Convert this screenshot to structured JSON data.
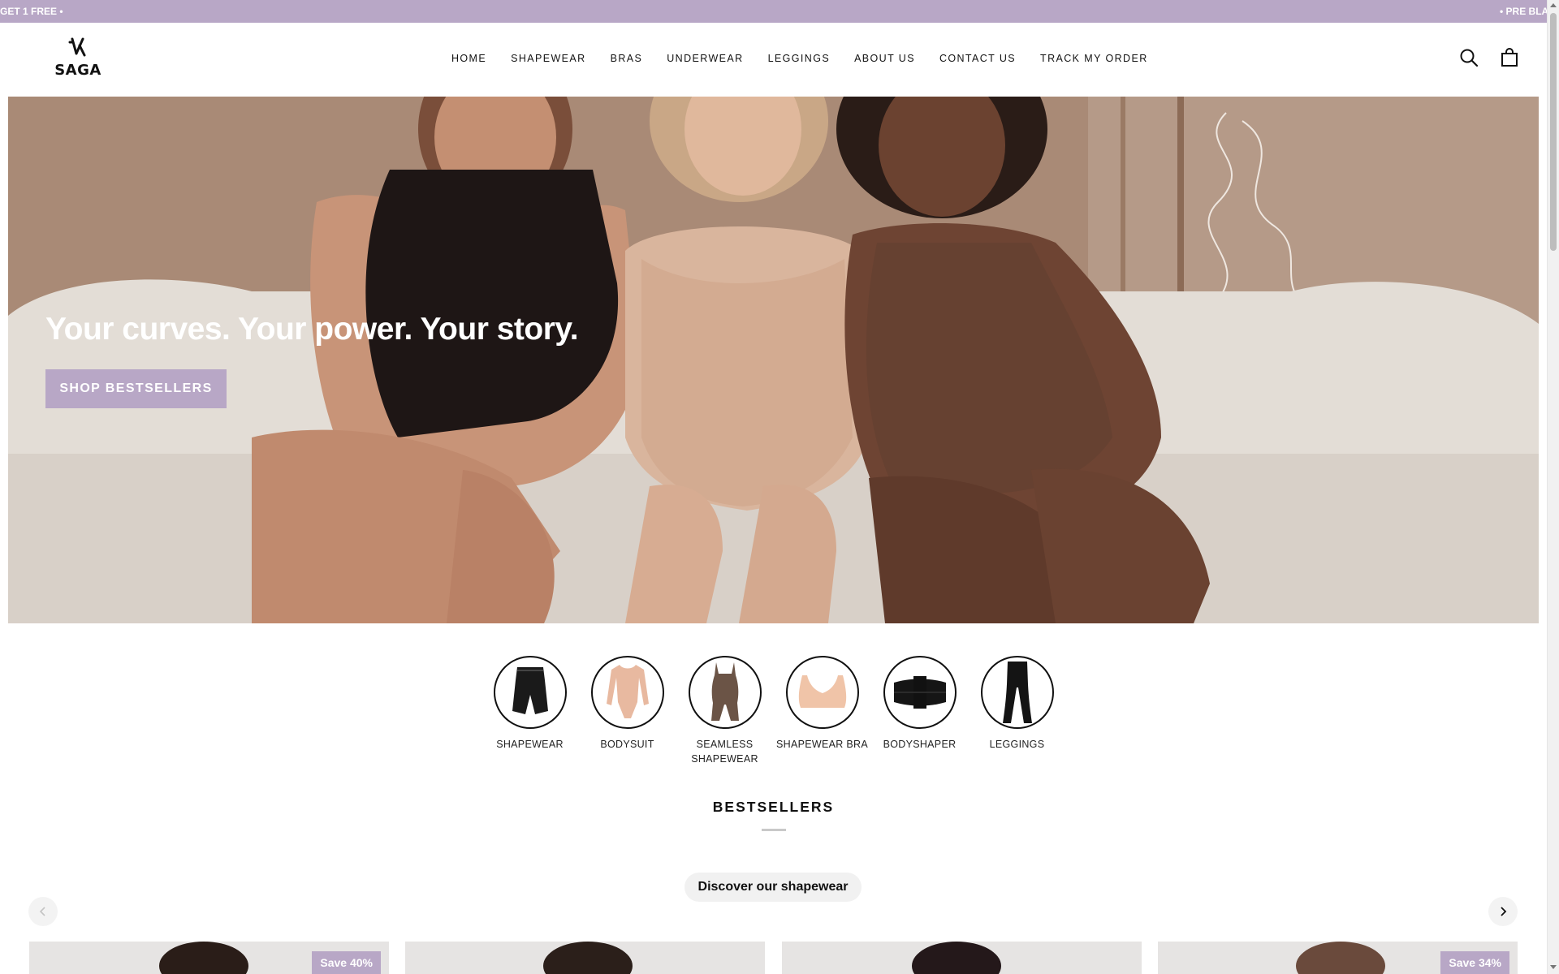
{
  "announcement": {
    "left_text": "GET 1 FREE •",
    "right_text": "• PRE BLA"
  },
  "header": {
    "logo_text": "SAGA",
    "nav": [
      {
        "label": "HOME"
      },
      {
        "label": "SHAPEWEAR"
      },
      {
        "label": "BRAS"
      },
      {
        "label": "UNDERWEAR"
      },
      {
        "label": "LEGGINGS"
      },
      {
        "label": "ABOUT US"
      },
      {
        "label": "CONTACT US"
      },
      {
        "label": "TRACK MY ORDER"
      }
    ],
    "icons": [
      "search-icon",
      "shopping-bag-icon"
    ]
  },
  "hero": {
    "title": "Your curves. Your power. Your story.",
    "button_label": "SHOP BESTSELLERS"
  },
  "categories": [
    {
      "label": "SHAPEWEAR",
      "icon": "shapewear-shorts-icon"
    },
    {
      "label": "BODYSUIT",
      "icon": "bodysuit-icon"
    },
    {
      "label": "SEAMLESS SHAPEWEAR",
      "icon": "seamless-shapewear-icon"
    },
    {
      "label": "SHAPEWEAR BRA",
      "icon": "bra-icon"
    },
    {
      "label": "BODYSHAPER",
      "icon": "waist-belt-icon"
    },
    {
      "label": "LEGGINGS",
      "icon": "leggings-icon"
    }
  ],
  "bestsellers": {
    "title": "BESTSELLERS",
    "discover_label": "Discover our shapewear",
    "products": [
      {
        "badge": "Save 40%"
      },
      {
        "badge": ""
      },
      {
        "badge": ""
      },
      {
        "badge": "Save 34%"
      }
    ]
  },
  "colors": {
    "accent": "#b8a7c6",
    "text": "#111111"
  }
}
